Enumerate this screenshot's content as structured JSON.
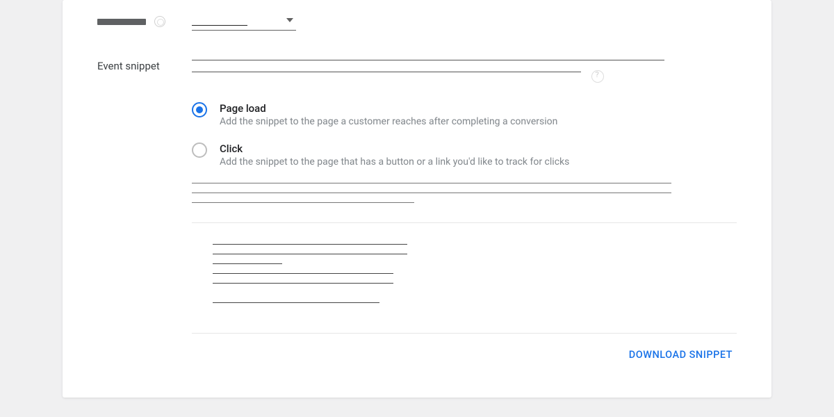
{
  "section_label": "Event snippet",
  "options": {
    "page_load": {
      "title": "Page load",
      "desc": "Add the snippet to the page a customer reaches after completing a conversion",
      "selected": true
    },
    "click": {
      "title": "Click",
      "desc": "Add the snippet to the page that has a button or a link you'd like to track for clicks",
      "selected": false
    }
  },
  "footer": {
    "download": "DOWNLOAD SNIPPET"
  }
}
